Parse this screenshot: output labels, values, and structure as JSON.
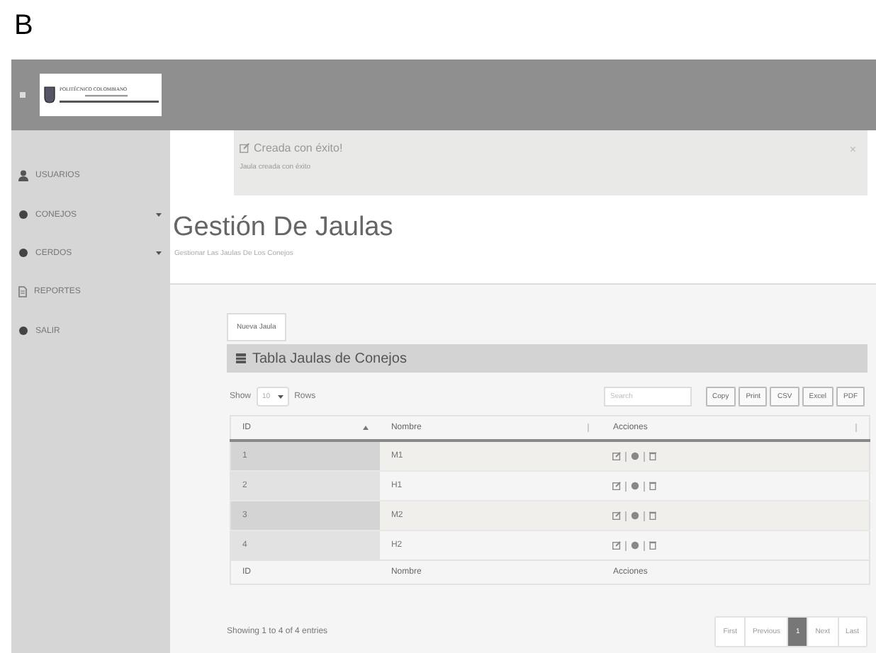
{
  "figure_label": "B",
  "header": {
    "logo_text": "POLITÉCNICO COLOMBIANO"
  },
  "sidebar": {
    "items": [
      {
        "label": "USUARIOS",
        "kind": "user",
        "has_submenu": false
      },
      {
        "label": "CONEJOS",
        "kind": "dot",
        "has_submenu": true
      },
      {
        "label": "CERDOS",
        "kind": "dot",
        "has_submenu": true
      },
      {
        "label": "REPORTES",
        "kind": "document",
        "has_submenu": false
      },
      {
        "label": "SALIR",
        "kind": "dot",
        "has_submenu": false
      }
    ]
  },
  "alert": {
    "title": "Creada con éxito!",
    "message": "Jaula creada con éxito",
    "close": "×"
  },
  "page": {
    "title": "Gestión De Jaulas",
    "subtitle": "Gestionar Las Jaulas De Los Conejos"
  },
  "new_button": "Nueva Jaula",
  "table_panel": {
    "title": "Tabla Jaulas de Conejos",
    "length": {
      "before": "Show",
      "value": "10",
      "after": "Rows"
    },
    "search": {
      "placeholder": "Search"
    },
    "export_buttons": [
      "Copy",
      "Print",
      "CSV",
      "Excel",
      "PDF"
    ],
    "columns": [
      {
        "label": "ID",
        "sorted": true
      },
      {
        "label": "Nombre",
        "sorted": false
      },
      {
        "label": "Acciones",
        "sorted": false
      }
    ],
    "rows": [
      {
        "id": "1",
        "name": "M1"
      },
      {
        "id": "2",
        "name": "H1"
      },
      {
        "id": "3",
        "name": "M2"
      },
      {
        "id": "4",
        "name": "H2"
      }
    ],
    "footer_columns": [
      "ID",
      "Nombre",
      "Acciones"
    ],
    "info": "Showing 1 to 4 of 4 entries",
    "pages": [
      {
        "label": "First",
        "selected": false
      },
      {
        "label": "Previous",
        "selected": false
      },
      {
        "label": "1",
        "selected": true
      },
      {
        "label": "Next",
        "selected": false
      },
      {
        "label": "Last",
        "selected": false
      }
    ]
  }
}
